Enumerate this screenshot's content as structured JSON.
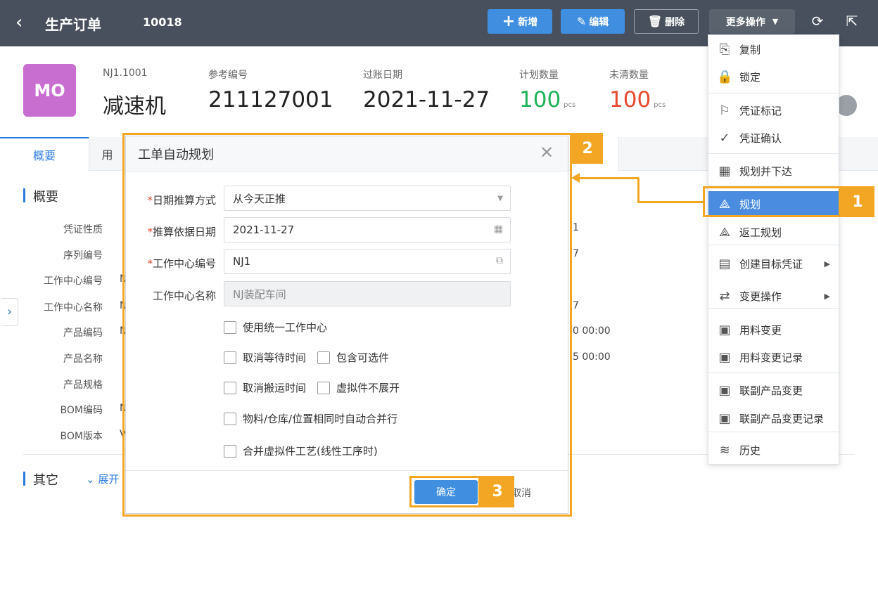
{
  "topbar": {
    "back_glyph": "‹",
    "title": "生产订单",
    "doc_no": "10018",
    "btn_add": "新增",
    "btn_edit": "编辑",
    "btn_delete": "删除",
    "btn_more": "更多操作"
  },
  "header": {
    "badge": "MO",
    "product_code": "NJ1.1001",
    "product_name": "减速机",
    "ref_label": "参考编号",
    "ref_value": "211127001",
    "post_date_label": "过账日期",
    "post_date_value": "2021-11-27",
    "plan_qty_label": "计划数量",
    "plan_qty_value": "100",
    "open_qty_label": "未清数量",
    "open_qty_value": "100",
    "unit": "pcs"
  },
  "tabs": {
    "overview": "概要",
    "second": "用"
  },
  "summary": {
    "title": "概要",
    "fields": [
      {
        "label": "凭证性质",
        "value": "",
        "right": "1"
      },
      {
        "label": "序列编号",
        "value": "",
        "right": "7"
      },
      {
        "label": "工作中心编号",
        "value": "N",
        "right": ""
      },
      {
        "label": "工作中心名称",
        "value": "N",
        "right": "7"
      },
      {
        "label": "产品编码",
        "value": "N",
        "right": "0 00:00"
      },
      {
        "label": "产品名称",
        "value": "",
        "right": "5 00:00"
      },
      {
        "label": "产品规格",
        "value": "",
        "right": ""
      },
      {
        "label": "BOM编码",
        "value": "N",
        "right": ""
      },
      {
        "label": "BOM版本",
        "value": "V",
        "right": ""
      }
    ],
    "other_title": "其它",
    "expand": "展开"
  },
  "menu": {
    "items": [
      {
        "label": "复制",
        "icon": "copy-icon"
      },
      {
        "label": "锁定",
        "icon": "lock-icon"
      },
      {
        "label": "凭证标记",
        "icon": "flag-icon"
      },
      {
        "label": "凭证确认",
        "icon": "check-circle-icon"
      },
      {
        "label": "规划并下达",
        "icon": "grid-icon"
      },
      {
        "label": "规划",
        "icon": "plan-icon"
      },
      {
        "label": "返工规划",
        "icon": "rework-plan-icon"
      },
      {
        "label": "创建目标凭证",
        "icon": "doc-icon"
      },
      {
        "label": "变更操作",
        "icon": "change-icon"
      },
      {
        "label": "用料变更",
        "icon": "material-change-icon"
      },
      {
        "label": "用料变更记录",
        "icon": "material-log-icon"
      },
      {
        "label": "联副产品变更",
        "icon": "coproduct-change-icon"
      },
      {
        "label": "联副产品变更记录",
        "icon": "coproduct-log-icon"
      },
      {
        "label": "历史",
        "icon": "layers-icon"
      }
    ]
  },
  "dialog": {
    "title": "工单自动规划",
    "date_method_label": "日期推算方式",
    "date_method_value": "从今天正推",
    "base_date_label": "推算依据日期",
    "base_date_value": "2021-11-27",
    "wc_code_label": "工作中心编号",
    "wc_code_value": "NJ1",
    "wc_name_label": "工作中心名称",
    "wc_name_value": "NJ装配车间",
    "cb_unified_wc": "使用统一工作中心",
    "cb_cancel_wait": "取消等待时间",
    "cb_include_optional": "包含可选件",
    "cb_cancel_move": "取消搬运时间",
    "cb_phantom_noexpand": "虚拟件不展开",
    "cb_merge_rows": "物料/仓库/位置相同时自动合并行",
    "cb_merge_phantom": "合并虚拟件工艺(线性工序时)",
    "ok": "确定",
    "cancel": "取消"
  },
  "annotations": {
    "n1": "1",
    "n2": "2",
    "n3": "3"
  },
  "colors": {
    "highlight": "#f2a623",
    "primary": "#3f8ee0",
    "topbar": "#47505c"
  }
}
